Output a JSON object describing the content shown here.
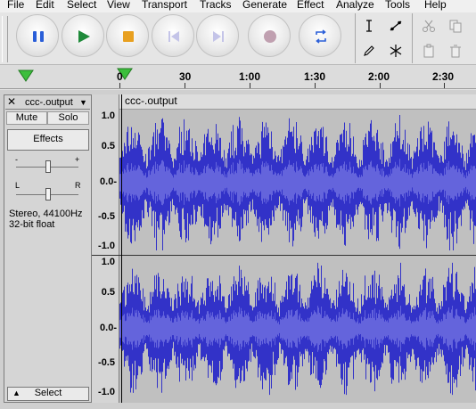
{
  "menu": [
    "File",
    "Edit",
    "Select",
    "View",
    "Transport",
    "Tracks",
    "Generate",
    "Effect",
    "Analyze",
    "Tools",
    "Help"
  ],
  "transport": [
    {
      "name": "pause-button",
      "icon": "pause-icon"
    },
    {
      "name": "play-button",
      "icon": "play-icon"
    },
    {
      "name": "stop-button",
      "icon": "stop-icon"
    },
    {
      "name": "skip-to-start-button",
      "icon": "skip-start-icon"
    },
    {
      "name": "skip-to-end-button",
      "icon": "skip-end-icon"
    },
    {
      "name": "record-button",
      "icon": "record-icon"
    },
    {
      "name": "loop-button",
      "icon": "loop-icon"
    }
  ],
  "ruler": {
    "labels": [
      "0",
      "30",
      "1:00",
      "1:30",
      "2:00",
      "2:30"
    ]
  },
  "track": {
    "name": "ccc-.output",
    "mute_label": "Mute",
    "solo_label": "Solo",
    "effects_label": "Effects",
    "gain_minus": "-",
    "gain_plus": "+",
    "pan_left": "L",
    "pan_right": "R",
    "format": "Stereo, 44100Hz\n32-bit float",
    "select_label": "Select",
    "clip_title": "ccc-.output"
  },
  "scale": {
    "labels": [
      "1.0",
      "0.5",
      "0.0-",
      "-0.5",
      "-1.0"
    ]
  },
  "colors": {
    "wave": "#3232c8",
    "wave_rms": "#6464dc",
    "play_green": "#1f8a3a",
    "pause_blue": "#2a5ed8",
    "stop_orange": "#e8a020"
  }
}
